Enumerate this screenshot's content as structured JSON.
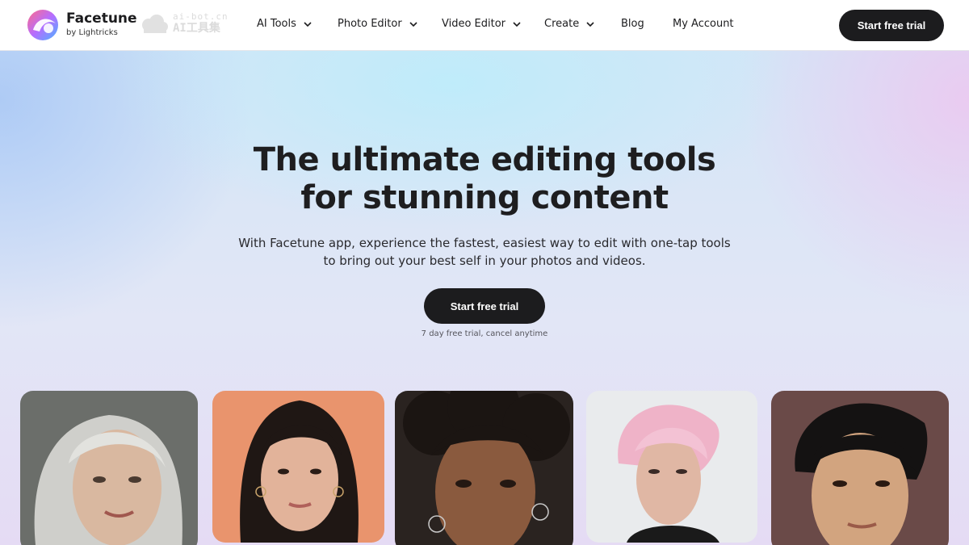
{
  "header": {
    "brand_name": "Facetune",
    "brand_sub": "by Lightricks",
    "watermark_top": "ai-bot.cn",
    "watermark_bottom": "AI工具集",
    "nav": [
      {
        "label": "AI Tools",
        "has_dropdown": true
      },
      {
        "label": "Photo Editor",
        "has_dropdown": true
      },
      {
        "label": "Video Editor",
        "has_dropdown": true
      },
      {
        "label": "Create",
        "has_dropdown": true
      },
      {
        "label": "Blog",
        "has_dropdown": false
      },
      {
        "label": "My Account",
        "has_dropdown": false
      }
    ],
    "cta_label": "Start free trial"
  },
  "hero": {
    "title_line1": "The ultimate editing tools",
    "title_line2": "for stunning content",
    "subtitle_line1": "With Facetune app, experience the fastest, easiest way to edit with one-tap tools",
    "subtitle_line2": "to bring out your best self in your photos and videos.",
    "cta_label": "Start free trial",
    "trial_note": "7 day free trial, cancel anytime"
  },
  "gallery": [
    {
      "name": "portrait-silver-hair-woman",
      "bg": "#6b6e6a",
      "skin": "#d9b8a0",
      "hair": "#cfcfcb"
    },
    {
      "name": "portrait-dark-hair-woman-orange-bg",
      "bg": "#e9946d",
      "skin": "#e2b39a",
      "hair": "#1f1714"
    },
    {
      "name": "portrait-curly-hair-woman",
      "bg": "#2a2320",
      "skin": "#8a5a3e",
      "hair": "#1b1512"
    },
    {
      "name": "portrait-pink-hair-person",
      "bg": "#e9ebed",
      "skin": "#e0b7a4",
      "hair": "#efb3c8"
    },
    {
      "name": "portrait-dark-hair-man",
      "bg": "#6a4a48",
      "skin": "#d2a47f",
      "hair": "#141212"
    }
  ],
  "colors": {
    "dark_button": "#1c1c1e",
    "text_primary": "#1e1e20"
  }
}
